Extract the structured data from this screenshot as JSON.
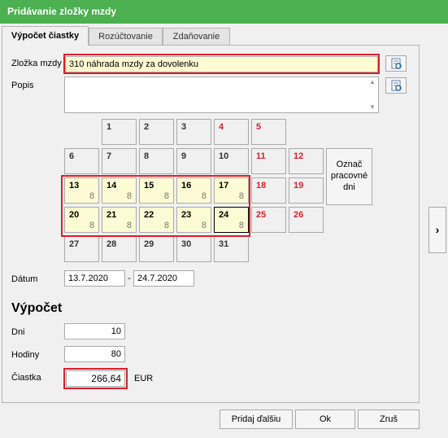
{
  "window": {
    "title": "Pridávanie zložky mzdy"
  },
  "tabs": [
    {
      "label": "Výpočet čiastky",
      "active": true
    },
    {
      "label": "Rozúčtovanie",
      "active": false
    },
    {
      "label": "Zdaňovanie",
      "active": false
    }
  ],
  "form": {
    "zlozka_label": "Zložka mzdy",
    "zlozka_value": "310  náhrada mzdy za dovolenku",
    "popis_label": "Popis",
    "popis_value": "",
    "datum_label": "Dátum",
    "date_from": "13.7.2020",
    "date_sep": "-",
    "date_to": "24.7.2020"
  },
  "calendar": {
    "mark_button_label": "Označ pracovné dni",
    "rows": [
      [
        {
          "day": ""
        },
        {
          "day": "1"
        },
        {
          "day": "2"
        },
        {
          "day": "3"
        },
        {
          "day": "4",
          "weekend": true
        },
        {
          "day": "5",
          "weekend": true
        }
      ],
      [
        {
          "day": "6"
        },
        {
          "day": "7"
        },
        {
          "day": "8"
        },
        {
          "day": "9"
        },
        {
          "day": "10"
        },
        {
          "day": "11",
          "weekend": true
        },
        {
          "day": "12",
          "weekend": true
        }
      ],
      [
        {
          "day": "13",
          "hours": "8",
          "selected": true
        },
        {
          "day": "14",
          "hours": "8",
          "selected": true
        },
        {
          "day": "15",
          "hours": "8",
          "selected": true
        },
        {
          "day": "16",
          "hours": "8",
          "selected": true
        },
        {
          "day": "17",
          "hours": "8",
          "selected": true
        },
        {
          "day": "18",
          "weekend": true
        },
        {
          "day": "19",
          "weekend": true
        }
      ],
      [
        {
          "day": "20",
          "hours": "8",
          "selected": true
        },
        {
          "day": "21",
          "hours": "8",
          "selected": true
        },
        {
          "day": "22",
          "hours": "8",
          "selected": true
        },
        {
          "day": "23",
          "hours": "8",
          "selected": true
        },
        {
          "day": "24",
          "hours": "8",
          "selected": true,
          "focused": true
        },
        {
          "day": "25",
          "weekend": true
        },
        {
          "day": "26",
          "weekend": true
        }
      ],
      [
        {
          "day": "27"
        },
        {
          "day": "28"
        },
        {
          "day": "29"
        },
        {
          "day": "30"
        },
        {
          "day": "31"
        }
      ]
    ]
  },
  "vypocet": {
    "heading": "Výpočet",
    "dni_label": "Dni",
    "dni_value": "10",
    "hodiny_label": "Hodiny",
    "hodiny_value": "80",
    "ciastka_label": "Čiastka",
    "ciastka_value": "266,64",
    "currency": "EUR"
  },
  "buttons": {
    "add_next": "Pridaj ďalšiu",
    "ok": "Ok",
    "cancel": "Zruš"
  },
  "colors": {
    "titlebar": "#4caf50",
    "highlight": "#d9202a",
    "selected_cell": "#fdfbd3",
    "weekend": "#d9202a"
  }
}
